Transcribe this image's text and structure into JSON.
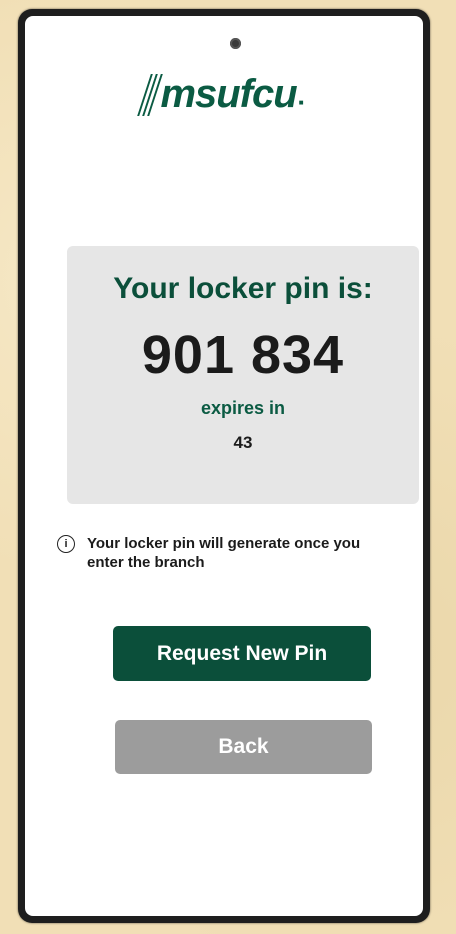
{
  "brand": {
    "logo_text": "msufcu",
    "color": "#0b5b43"
  },
  "pin_card": {
    "heading": "Your locker pin is:",
    "pin": "901 834",
    "expires_label": "expires in",
    "expires_value": "43"
  },
  "info": {
    "icon": "info-icon",
    "message": "Your locker pin will generate once you enter the branch"
  },
  "actions": {
    "request_new_pin_label": "Request New Pin",
    "back_label": "Back"
  },
  "colors": {
    "primary": "#0b4f3a",
    "card_background": "#e6e6e6",
    "secondary_button": "#9c9c9c"
  }
}
